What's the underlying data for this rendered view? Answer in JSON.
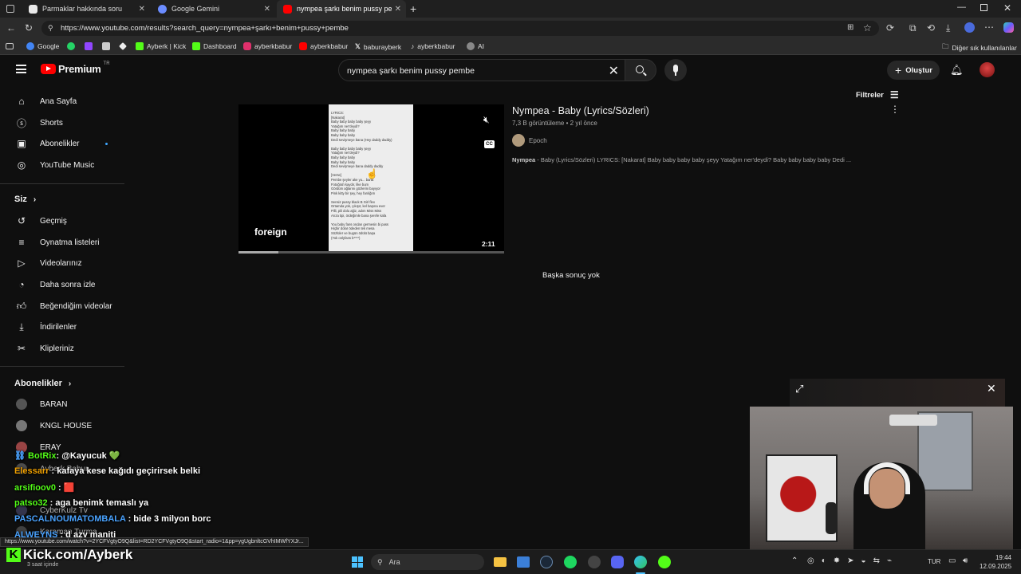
{
  "tabs": [
    {
      "title": "Parmaklar hakkında soru",
      "color": "#e8e8e8"
    },
    {
      "title": "Google Gemini",
      "color": "#6b8cff"
    },
    {
      "title": "nympea şarkı benim pussy pembe",
      "color": "#ff0000"
    }
  ],
  "address": {
    "url": "https://www.youtube.com/results?search_query=nympea+şarkı+benim+pussy+pembe"
  },
  "bookmarks": [
    {
      "label": "Google",
      "color": "#4285f4"
    },
    {
      "label": "",
      "color": "#25d366"
    },
    {
      "label": "",
      "color": "#9146ff"
    },
    {
      "label": "",
      "color": "#cccccc"
    },
    {
      "label": "Ayberk | Kick",
      "color": "#53fc18"
    },
    {
      "label": "Dashboard",
      "color": "#53fc18"
    },
    {
      "label": "ayberkbabur",
      "color": "#e1306c"
    },
    {
      "label": "ayberkbabur",
      "color": "#ff0000"
    },
    {
      "label": "baburayberk",
      "color": "#111111"
    },
    {
      "label": "ayberkbabur",
      "color": "#111111"
    },
    {
      "label": "AI",
      "color": "#aaaaaa"
    }
  ],
  "bookmarks_other": "Diğer sık kullanılanlar",
  "yt": {
    "logo": "Premium",
    "logo_sup": "TR",
    "search_value": "nympea şarkı benim pussy pembe",
    "create": "Oluştur",
    "filters": "Filtreler"
  },
  "sidebar": {
    "main": [
      {
        "label": "Ana Sayfa",
        "icon": "home-icon"
      },
      {
        "label": "Shorts",
        "icon": "shorts-icon"
      },
      {
        "label": "Abonelikler",
        "icon": "subscriptions-icon"
      },
      {
        "label": "YouTube Music",
        "icon": "music-icon"
      }
    ],
    "you_title": "Siz",
    "you": [
      {
        "label": "Geçmiş",
        "icon": "history-icon"
      },
      {
        "label": "Oynatma listeleri",
        "icon": "playlist-icon"
      },
      {
        "label": "Videolarınız",
        "icon": "video-icon"
      },
      {
        "label": "Daha sonra izle",
        "icon": "clock-icon"
      },
      {
        "label": "Beğendiğim videolar",
        "icon": "thumbs-up-icon"
      },
      {
        "label": "İndirilenler",
        "icon": "download-icon"
      },
      {
        "label": "Klipleriniz",
        "icon": "scissors-icon"
      }
    ],
    "subs_title": "Abonelikler",
    "subs": [
      "BARAN",
      "KNGL HOUSE",
      "ERAY",
      "Ayberk Babur",
      "",
      "CyberKulz Tv",
      "Karaman Turma"
    ]
  },
  "result": {
    "title": "Nympea - Baby (Lyrics/Sözleri)",
    "views": "7,3 B görüntüleme",
    "age": "2 yıl önce",
    "channel": "Epoch",
    "desc_bold": "Nympea",
    "desc": " - Baby (Lyrics/Sözleri) LYRICS: [Nakarat] Baby baby baby baby şeyy Yatağım ner'deydi? Baby baby baby baby Dedi ...",
    "duration": "2:11",
    "badge": "foreign",
    "lyrics": [
      "LYRICS:",
      "[Nakarat]",
      "Baby baby baby baby şeyy",
      "Yatağım ner'deydi?",
      "Baby baby baby",
      "Baby baby baby",
      "Dedi sevişmeye bana (Hey daddy daddy)",
      "",
      "Baby baby baby baby şeyy",
      "Yatağım ner'deydi?",
      "Baby baby baby",
      "Baby baby baby",
      "Dedi sevişmeye bana daddy daddy",
      "",
      "[Verse]",
      "Pembe şeyler ake yu... barta",
      "Fotoğrafı kaydır, like bum",
      "Gördüm ağlarını gözlerini bayıyor",
      "Pink kitty bir şey, hey fanlığım",
      "",
      "Sensiz pussy black B Girl flex",
      "Ortamda yok, çıkışıt, kel başına ever",
      "Pilli, pili dolu ağiz,  adım Miss Miss",
      "Arıza tipi, ördeğimle bana şerefe kafa",
      "",
      "You baby fans ondan germesin bi pass",
      "Hiçbir dolar ödeden tek mesa",
      "Sözlüler ve bugün ödülü başa",
      "(Yok onlyfans b****)"
    ],
    "no_more": "Başka sonuç yok"
  },
  "chat": [
    {
      "user": "BotRix",
      "userColor": "#53fc18",
      "msg": ": @Kayucuk 💚"
    },
    {
      "user": "Elessarr",
      "userColor": "#f0a000",
      "msg": " : kafaya kese kağıdı geçirirsek belki"
    },
    {
      "user": "arsifioov0",
      "userColor": "#53fc18",
      "msg": " : 🟥"
    },
    {
      "user": "patso32",
      "userColor": "#53fc18",
      "msg": " : aga benimk temaslı ya"
    },
    {
      "user": "PASCALNOUMATOMBALA",
      "userColor": "#4aa3ff",
      "msg": " : bide 3 milyon borc"
    },
    {
      "user": "ALWEYNS",
      "userColor": "#4aa3ff",
      "msg": " : d azy maniti"
    }
  ],
  "status_url": "https://www.youtube.com/watch?v=2YCFVgtyO9Q&list=RD2YCFVgtyO9Q&start_radio=1&pp=ygUgbnltcGVhIMWfYXJr...",
  "kick_brand": "Kick.com/Ayberk",
  "kick_sub": "3 saat içinde",
  "taskbar": {
    "search": "Ara",
    "lang": "TUR",
    "time": "19:44",
    "date": "12.09.2025"
  }
}
